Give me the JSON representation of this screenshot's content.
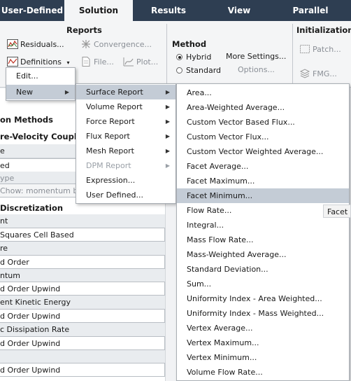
{
  "tabs": [
    "User-Defined",
    "Solution",
    "Results",
    "View",
    "Parallel"
  ],
  "ribbon": {
    "reports_title": "Reports",
    "residuals": "Residuals...",
    "convergence": "Convergence...",
    "definitions": "Definitions",
    "file": "File...",
    "plot": "Plot...",
    "method_title": "Method",
    "hybrid": "Hybrid",
    "more_settings": "More Settings...",
    "standard": "Standard",
    "options": "Options...",
    "init_title": "Initialization",
    "patch": "Patch...",
    "fmg": "FMG..."
  },
  "panel": {
    "methods_title": "on Methods",
    "coupling_title": "re-Velocity Coupli",
    "rows": [
      "e",
      "ed",
      "ype",
      "Chow: momentum b"
    ],
    "discretization_title": " Discretization",
    "disc_rows": [
      {
        "label": "nt",
        "value": "Squares Cell Based"
      },
      {
        "label": "re",
        "value": "d Order"
      },
      {
        "label": "ntum",
        "value": "d Order Upwind"
      },
      {
        "label": "ent Kinetic Energy",
        "value": "d Order Upwind"
      },
      {
        "label": "c Dissipation Rate",
        "value": "d Order Upwind"
      },
      {
        "label": "",
        "value": "d Order Upwind"
      }
    ]
  },
  "menu_definitions": {
    "items": [
      "Edit...",
      "New"
    ]
  },
  "menu_new": {
    "items": [
      "Surface Report",
      "Volume Report",
      "Force Report",
      "Flux Report",
      "Mesh Report",
      "DPM Report",
      "Expression...",
      "User Defined..."
    ]
  },
  "menu_surface": {
    "items": [
      "Area...",
      "Area-Weighted Average...",
      "Custom Vector Based Flux...",
      "Custom Vector Flux...",
      "Custom Vector Weighted Average...",
      "Facet Average...",
      "Facet Maximum...",
      "Facet Minimum...",
      "Flow Rate...",
      "Integral...",
      "Mass Flow Rate...",
      "Mass-Weighted Average...",
      "Standard Deviation...",
      "Sum...",
      "Uniformity Index - Area Weighted...",
      "Uniformity Index - Mass Weighted...",
      "Vertex Average...",
      "Vertex Maximum...",
      "Vertex Minimum...",
      "Volume Flow Rate..."
    ]
  },
  "tooltip": "Facet M",
  "colors": {
    "tabbar": "#2e3e52",
    "highlight": "#c4ccd6"
  }
}
